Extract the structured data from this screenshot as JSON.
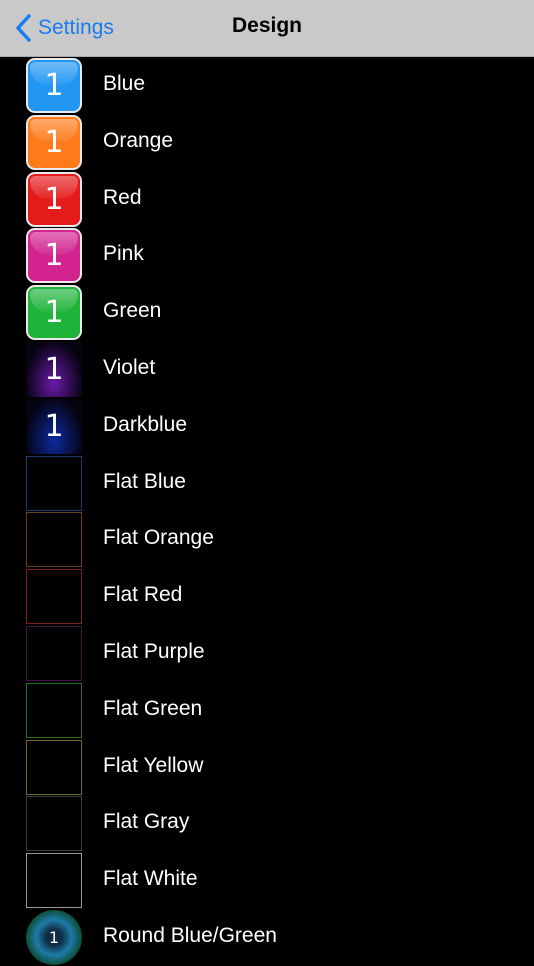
{
  "navbar": {
    "back_label": "Settings",
    "title": "Design"
  },
  "icon_digit": "1",
  "rows": [
    {
      "label": "Blue",
      "style": "glossy",
      "color": "#2196f3"
    },
    {
      "label": "Orange",
      "style": "glossy",
      "color": "#ff7a1a"
    },
    {
      "label": "Red",
      "style": "glossy",
      "color": "#e51b1b"
    },
    {
      "label": "Pink",
      "style": "glossy",
      "color": "#d2238f"
    },
    {
      "label": "Green",
      "style": "glossy",
      "color": "#1fb33a"
    },
    {
      "label": "Violet",
      "style": "dark",
      "color": "#6a1aa8"
    },
    {
      "label": "Darkblue",
      "style": "dark",
      "color": "#0c2aa0"
    },
    {
      "label": "Flat Blue",
      "style": "flat",
      "color": "#1e3a66"
    },
    {
      "label": "Flat Orange",
      "style": "flat",
      "color": "#6a3f1c"
    },
    {
      "label": "Flat Red",
      "style": "flat",
      "color": "#7a1e1e"
    },
    {
      "label": "Flat Purple",
      "style": "flat",
      "color": "#3f1342"
    },
    {
      "label": "Flat Green",
      "style": "flat",
      "color": "#1f6e2a"
    },
    {
      "label": "Flat Yellow",
      "style": "flat",
      "color": "#6b6a28"
    },
    {
      "label": "Flat Gray",
      "style": "flat",
      "color": "#3c3c3c"
    },
    {
      "label": "Flat White",
      "style": "flat",
      "color": "#9a9a9a"
    },
    {
      "label": "Round Blue/Green",
      "style": "round",
      "color": "#1e7aa8"
    }
  ]
}
